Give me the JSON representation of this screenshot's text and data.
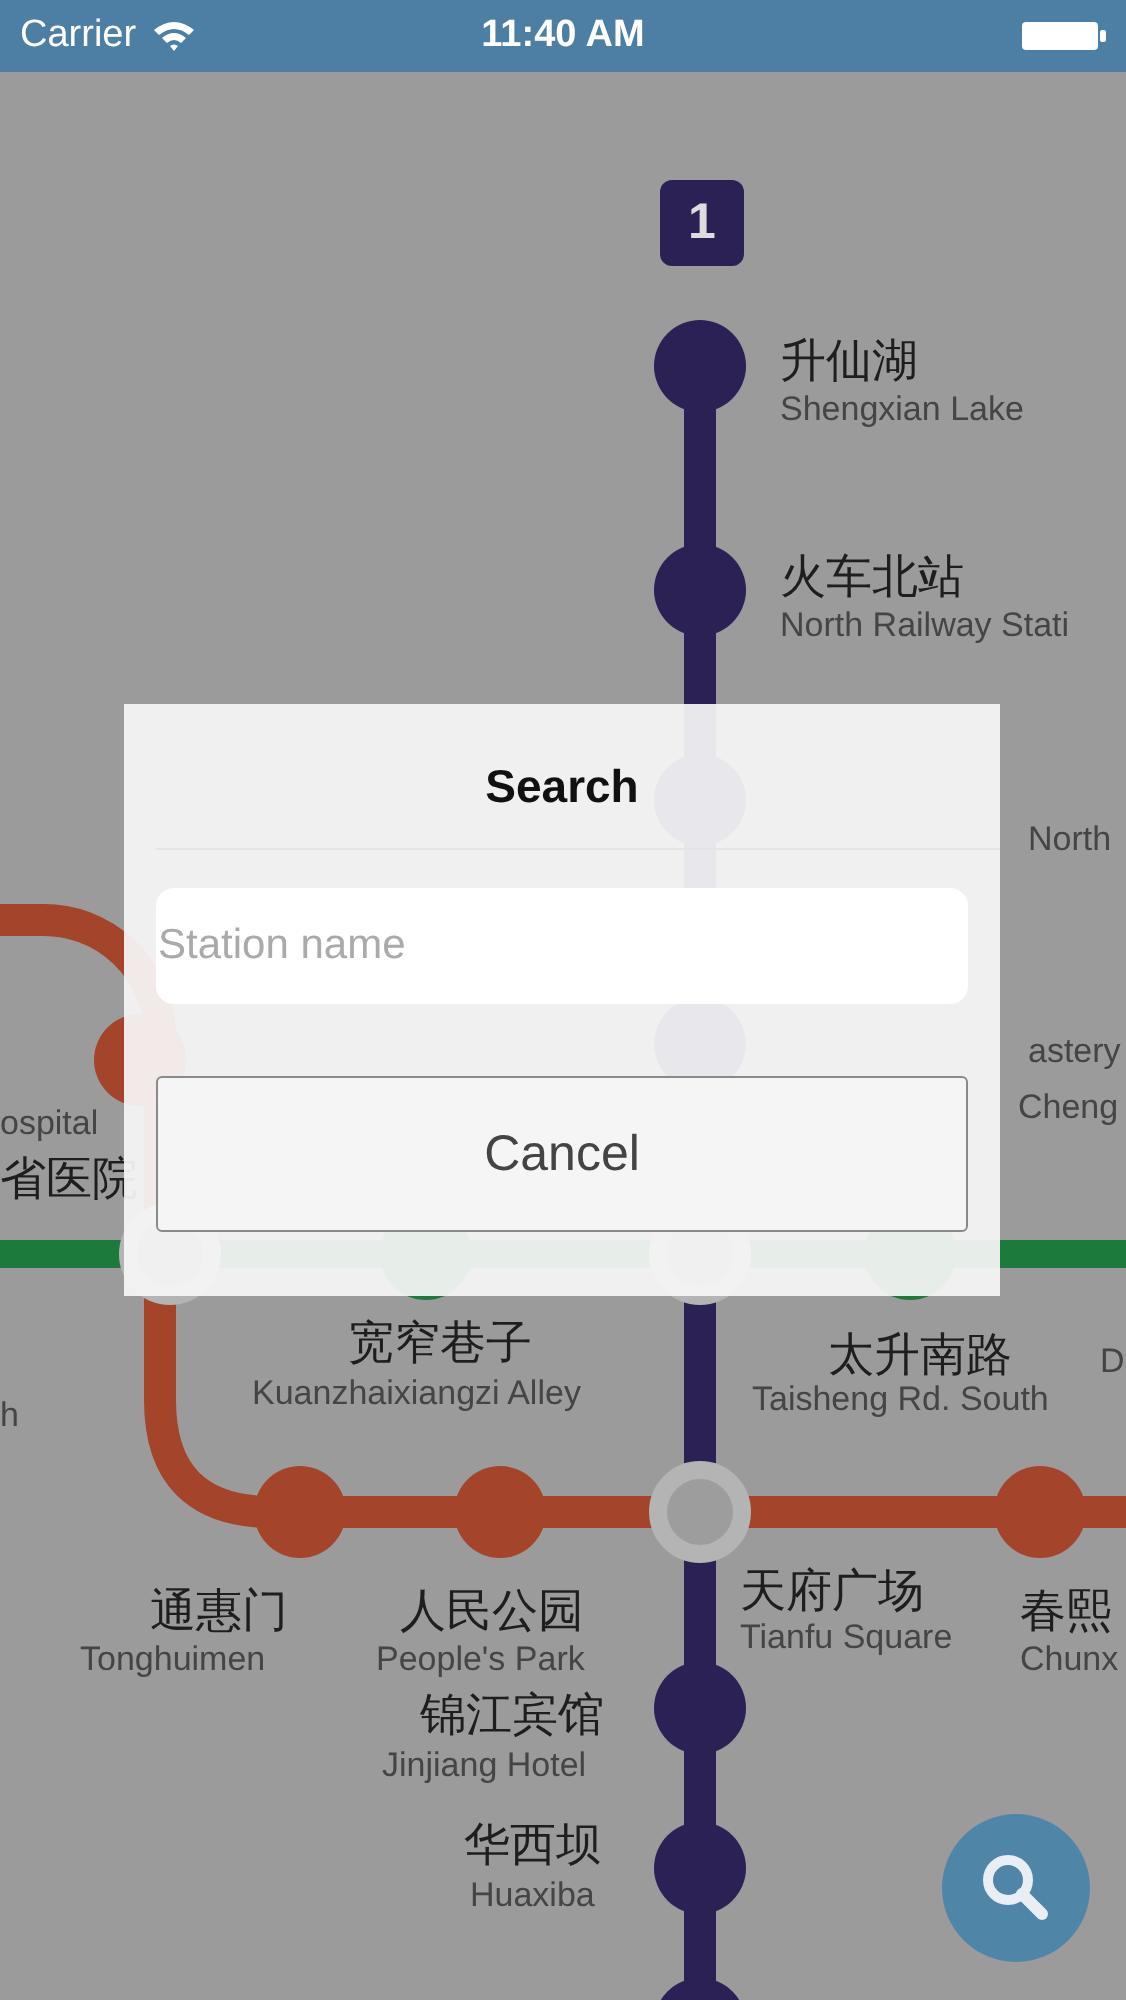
{
  "status_bar": {
    "carrier": "Carrier",
    "time": "11:40 AM"
  },
  "map": {
    "line_badge": "1",
    "lines": [
      {
        "color": "#2b2155"
      },
      {
        "color": "#1b7a3c"
      },
      {
        "color": "#a3442b"
      }
    ],
    "labels": [
      {
        "text": "升仙湖",
        "kind": "zh"
      },
      {
        "text": "Shengxian Lake",
        "kind": "en"
      },
      {
        "text": "火车北站",
        "kind": "zh"
      },
      {
        "text": "North Railway Stati",
        "kind": "en"
      },
      {
        "text": "North",
        "kind": "en"
      },
      {
        "text": "astery",
        "kind": "en"
      },
      {
        "text": "Cheng",
        "kind": "en"
      },
      {
        "text": "ospital",
        "kind": "en"
      },
      {
        "text": "省医院",
        "kind": "zh"
      },
      {
        "text": "宽窄巷子",
        "kind": "zh"
      },
      {
        "text": "Kuanzhaixiangzi Alley",
        "kind": "en"
      },
      {
        "text": "太升南路",
        "kind": "zh"
      },
      {
        "text": "Taisheng Rd. South",
        "kind": "en"
      },
      {
        "text": "D",
        "kind": "en"
      },
      {
        "text": "h",
        "kind": "en"
      },
      {
        "text": "通惠门",
        "kind": "zh"
      },
      {
        "text": "Tonghuimen",
        "kind": "en"
      },
      {
        "text": "人民公园",
        "kind": "zh"
      },
      {
        "text": "People's Park",
        "kind": "en"
      },
      {
        "text": "天府广场",
        "kind": "zh"
      },
      {
        "text": "Tianfu Square",
        "kind": "en"
      },
      {
        "text": "春熙",
        "kind": "zh"
      },
      {
        "text": "Chunx",
        "kind": "en"
      },
      {
        "text": "锦江宾馆",
        "kind": "zh"
      },
      {
        "text": "Jinjiang Hotel",
        "kind": "en"
      },
      {
        "text": "华西坝",
        "kind": "zh"
      },
      {
        "text": "Huaxiba",
        "kind": "en"
      }
    ]
  },
  "dialog": {
    "title": "Search",
    "placeholder": "Station name",
    "cancel": "Cancel"
  }
}
